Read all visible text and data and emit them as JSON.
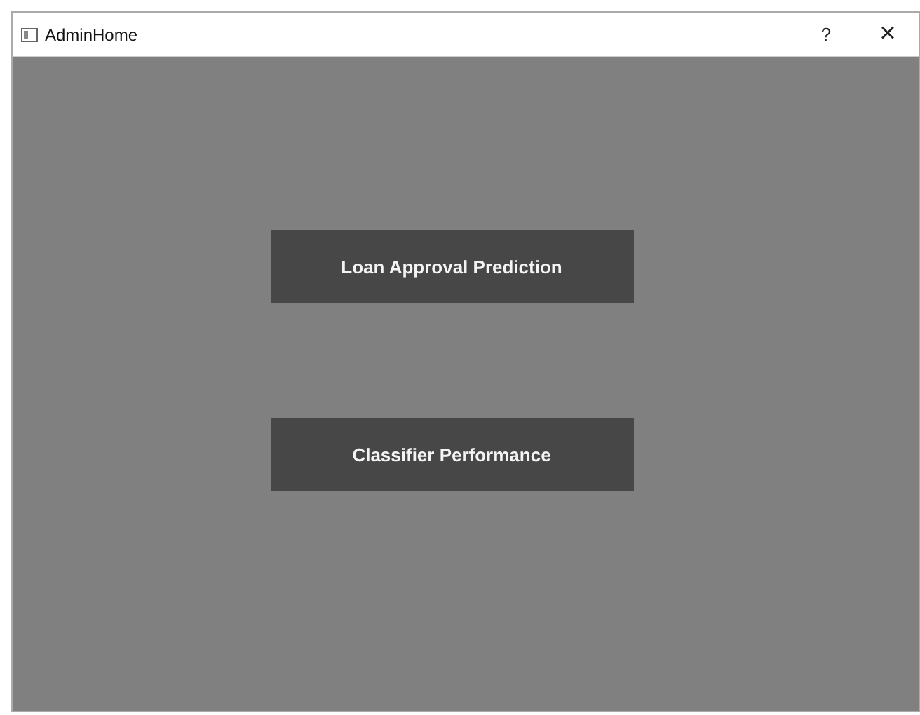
{
  "window": {
    "title": "AdminHome",
    "help": "?",
    "close": "×"
  },
  "buttons": [
    {
      "label": "Loan Approval Prediction"
    },
    {
      "label": "Classifier Performance"
    }
  ]
}
